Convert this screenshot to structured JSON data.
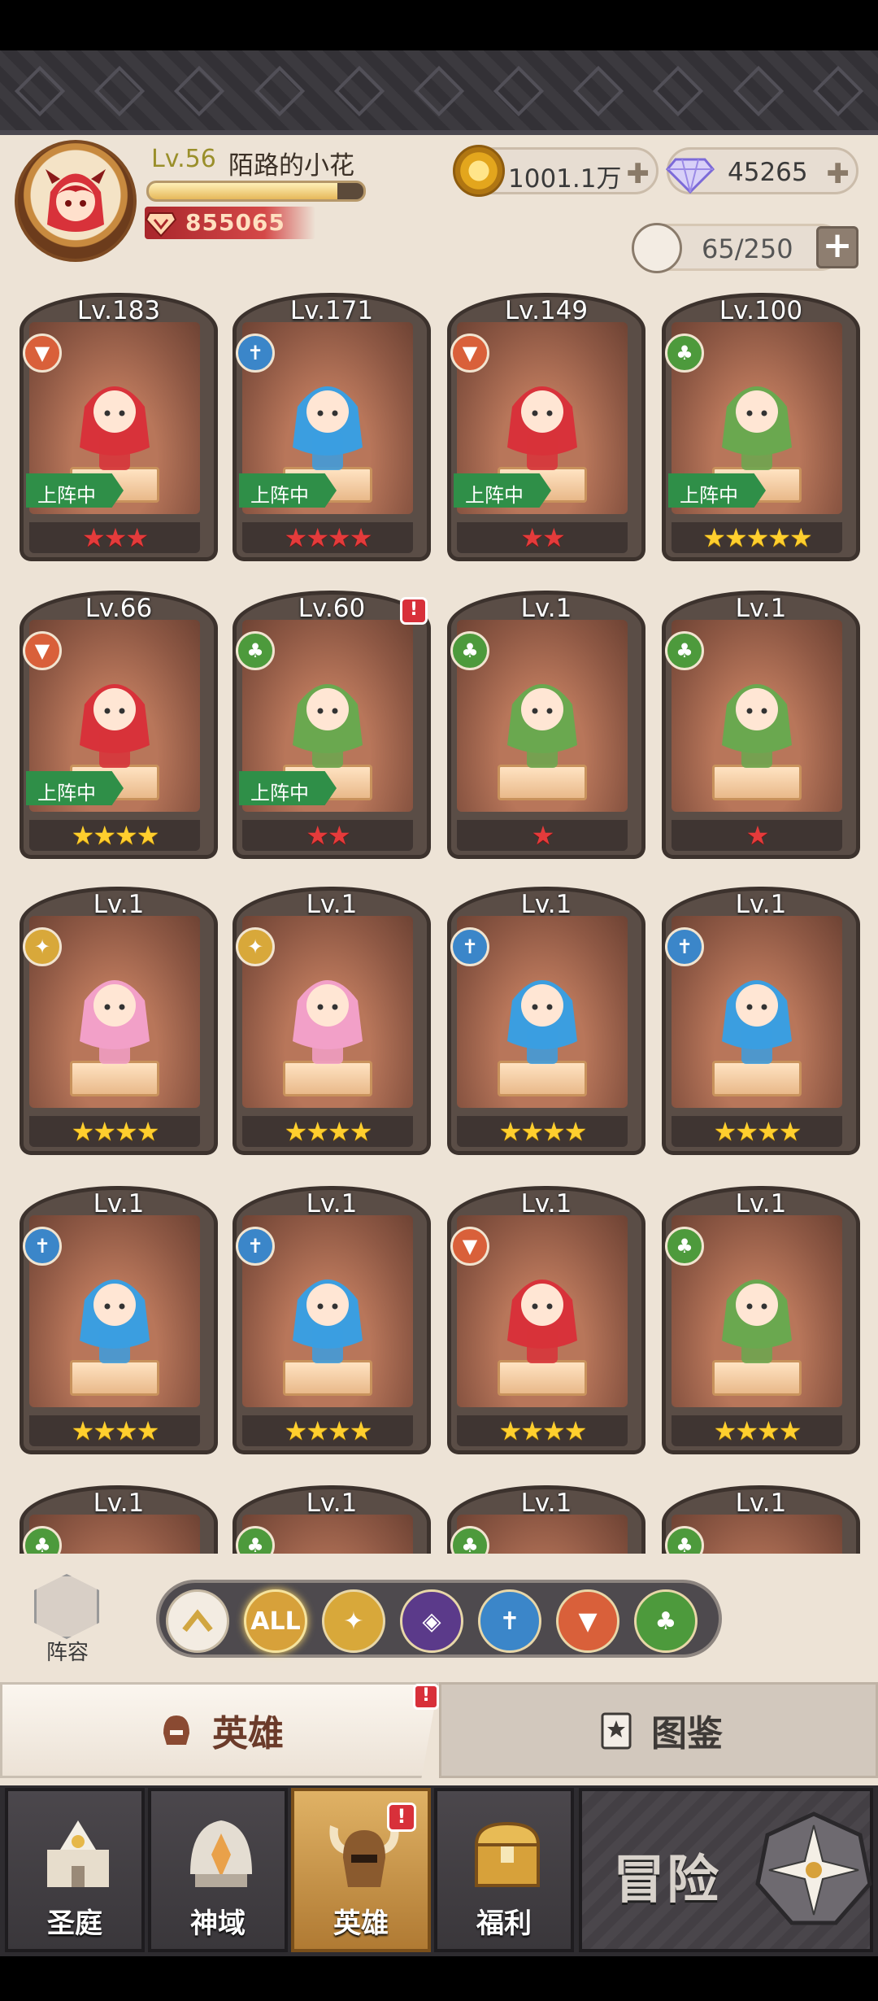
{
  "player": {
    "level": "Lv.56",
    "name": "陌路的小花",
    "xp_fraction": 0.88,
    "power": "855065"
  },
  "currency": {
    "gold": "1001.1万",
    "gems": "45265"
  },
  "hero_count": "65/250",
  "heroes": [
    {
      "level": "Lv.183",
      "element": "fire",
      "deployed_label": "上阵中",
      "deployed": true,
      "stars": "★★★",
      "star_color": "red"
    },
    {
      "level": "Lv.171",
      "element": "water",
      "deployed_label": "上阵中",
      "deployed": true,
      "stars": "★★★★",
      "star_color": "red"
    },
    {
      "level": "Lv.149",
      "element": "fire",
      "deployed_label": "上阵中",
      "deployed": true,
      "stars": "★★",
      "star_color": "red"
    },
    {
      "level": "Lv.100",
      "element": "nature",
      "deployed_label": "上阵中",
      "deployed": true,
      "stars": "★★★★★",
      "star_color": "gold"
    },
    {
      "level": "Lv.66",
      "element": "fire",
      "deployed_label": "上阵中",
      "deployed": true,
      "stars": "★★★★",
      "star_color": "gold"
    },
    {
      "level": "Lv.60",
      "element": "nature",
      "deployed_label": "上阵中",
      "deployed": true,
      "stars": "★★",
      "star_color": "red",
      "alert": "!"
    },
    {
      "level": "Lv.1",
      "element": "nature",
      "deployed": false,
      "stars": "★",
      "star_color": "red"
    },
    {
      "level": "Lv.1",
      "element": "nature",
      "deployed": false,
      "stars": "★",
      "star_color": "red"
    },
    {
      "level": "Lv.1",
      "element": "light",
      "deployed": false,
      "stars": "★★★★",
      "star_color": "gold"
    },
    {
      "level": "Lv.1",
      "element": "light",
      "deployed": false,
      "stars": "★★★★",
      "star_color": "gold"
    },
    {
      "level": "Lv.1",
      "element": "water",
      "deployed": false,
      "stars": "★★★★",
      "star_color": "gold"
    },
    {
      "level": "Lv.1",
      "element": "water",
      "deployed": false,
      "stars": "★★★★",
      "star_color": "gold"
    },
    {
      "level": "Lv.1",
      "element": "water",
      "deployed": false,
      "stars": "★★★★",
      "star_color": "gold"
    },
    {
      "level": "Lv.1",
      "element": "water",
      "deployed": false,
      "stars": "★★★★",
      "star_color": "gold"
    },
    {
      "level": "Lv.1",
      "element": "fire",
      "deployed": false,
      "stars": "★★★★",
      "star_color": "gold"
    },
    {
      "level": "Lv.1",
      "element": "nature",
      "deployed": false,
      "stars": "★★★★",
      "star_color": "gold"
    },
    {
      "level": "Lv.1",
      "element": "nature",
      "deployed": false,
      "stars": "",
      "star_color": "gold"
    },
    {
      "level": "Lv.1",
      "element": "nature",
      "deployed": false,
      "stars": "",
      "star_color": "gold"
    },
    {
      "level": "Lv.1",
      "element": "nature",
      "deployed": false,
      "stars": "",
      "star_color": "gold"
    },
    {
      "level": "Lv.1",
      "element": "nature",
      "deployed": false,
      "stars": "",
      "star_color": "gold"
    }
  ],
  "lineup_label": "阵容",
  "filters": [
    {
      "name": "rank",
      "label": ""
    },
    {
      "name": "all",
      "label": "ALL"
    },
    {
      "name": "light",
      "label": ""
    },
    {
      "name": "dark",
      "label": ""
    },
    {
      "name": "water",
      "label": ""
    },
    {
      "name": "fire",
      "label": ""
    },
    {
      "name": "nature",
      "label": ""
    }
  ],
  "tabs": {
    "heroes": "英雄",
    "codex": "图鉴",
    "heroes_alert": "!"
  },
  "nav": {
    "court": "圣庭",
    "domain": "神域",
    "heroes": "英雄",
    "welfare": "福利",
    "adventure": "冒险",
    "heroes_alert": "!"
  },
  "colors": {
    "background": "#ede3d6",
    "deployed_tag": "#2f8f48",
    "alert": "#d8303a",
    "fire": "#d9603a",
    "water": "#3b86c9",
    "nature": "#4d9a3c",
    "light": "#d8a83a"
  }
}
